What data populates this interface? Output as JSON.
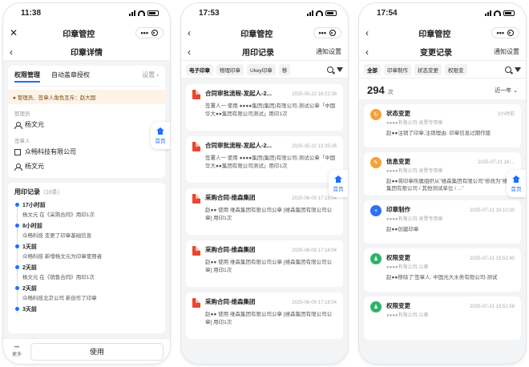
{
  "colors": {
    "accent": "#1f6fff",
    "pdf": "#e8462e",
    "orange": "#f2a33a",
    "blue": "#2f6ff2",
    "green": "#2fb36b"
  },
  "phone1": {
    "status": {
      "time": "11:38"
    },
    "nav": {
      "title": "印章管控"
    },
    "sub": {
      "title": "印章详情"
    },
    "tabs": [
      "权限管理",
      "自动盖章授权"
    ],
    "settings": "设置 ›",
    "warning": "● 管理员、签章人角色互斥：赵大国",
    "admin_label": "管理员",
    "admin": "杨文元",
    "signer_label": "签章人",
    "company": "众畅科技有限公司",
    "signer": "杨文元",
    "records_title": "用印记录",
    "records_count": "（10条）",
    "timeline": [
      {
        "time": "17小时前",
        "desc": "杨文元 在《采购合同》用印1次"
      },
      {
        "time": "8小时前",
        "desc": "众畅科技 变更了印章基础信息"
      },
      {
        "time": "1天前",
        "desc": "众畅科技 新增杨文元为印章使用者"
      },
      {
        "time": "2天前",
        "desc": "杨文元 在《销售合同》用印1次"
      },
      {
        "time": "2天前",
        "desc": "众畅科技北京公司 新创作了印章"
      },
      {
        "time": "3天前",
        "desc": ""
      }
    ],
    "more": "更多",
    "use_button": "使用",
    "home": "首页"
  },
  "phone2": {
    "status": {
      "time": "17:53"
    },
    "nav": {
      "title": "印章管控"
    },
    "sub": {
      "title": "用印记录",
      "right": "通知设置"
    },
    "chips": [
      "电子印章",
      "物理印章",
      "Ukey印章",
      "移"
    ],
    "records": [
      {
        "title": "合同审批流程-发起人-2...",
        "date": "2025-05-22 16:22:38",
        "text": "签署人一 使用 ●●●●集团(集团)有限公司-测试公章「中国华大●●集团有限公司测试」用印1次"
      },
      {
        "title": "合同审批流程-发起人-2...",
        "date": "2025-05-22 13:35:26",
        "text": "签署人一 使用 ●●●●集团(集团)有限公司-测试公章「中国华大●●集团有限公司测试」用印1次"
      },
      {
        "title": "采购合同-维森集团",
        "date": "2025-06-09 17:18:04",
        "text": "赵●● 使用 维森集团有限公司公章 [维森集团有限公司公章] 用印1次"
      },
      {
        "title": "采购合同-维森集团",
        "date": "2025-06-09 17:18:04",
        "text": "赵●● 使用 维森集团有限公司公章 [维森集团有限公司公章] 用印1次"
      },
      {
        "title": "采购合同-维森集团",
        "date": "2025-06-09 17:18:04",
        "text": "赵●● 使用 维森集团有限公司公章 [维森集团有限公司公章] 用印1次"
      }
    ],
    "home": "首页"
  },
  "phone3": {
    "status": {
      "time": "17:54"
    },
    "nav": {
      "title": "印章管控"
    },
    "sub": {
      "title": "变更记录",
      "right": "通知设置"
    },
    "chips": [
      "全部",
      "印章制作",
      "状态变更",
      "权限变"
    ],
    "count": "294",
    "count_unit": "次",
    "range": "近一年 ⌄",
    "changes": [
      {
        "title": "状态变更",
        "seal": "●●●●有限公司-发票专用章",
        "date": "3小时前",
        "text": "赵●●注销了印章,注销理由: 印章信息过期作废"
      },
      {
        "title": "信息变更",
        "seal": "●●●●有限公司-发票专用章",
        "date": "2025-07-21 16:...",
        "text": "赵●●将印章所属组织从\"维森集团有限公司\"修改为\"维森集团有限公司 / 其他测试单位 / ...\""
      },
      {
        "title": "印章制作",
        "seal": "●●●●有限公司-发票专用章",
        "date": "2025-07-21 16:10:30",
        "text": "赵●●创建印章"
      },
      {
        "title": "权限变更",
        "seal": "●●●●有限公司-公章",
        "date": "2025-07-21 15:52:40",
        "text": "赵●●移除了'签章人: 中国光大水务有限公司-测试"
      },
      {
        "title": "权限变更",
        "seal": "●●●●有限公司-公章",
        "date": "2025-07-21 15:51:58",
        "text": ""
      }
    ],
    "home": "首页"
  }
}
